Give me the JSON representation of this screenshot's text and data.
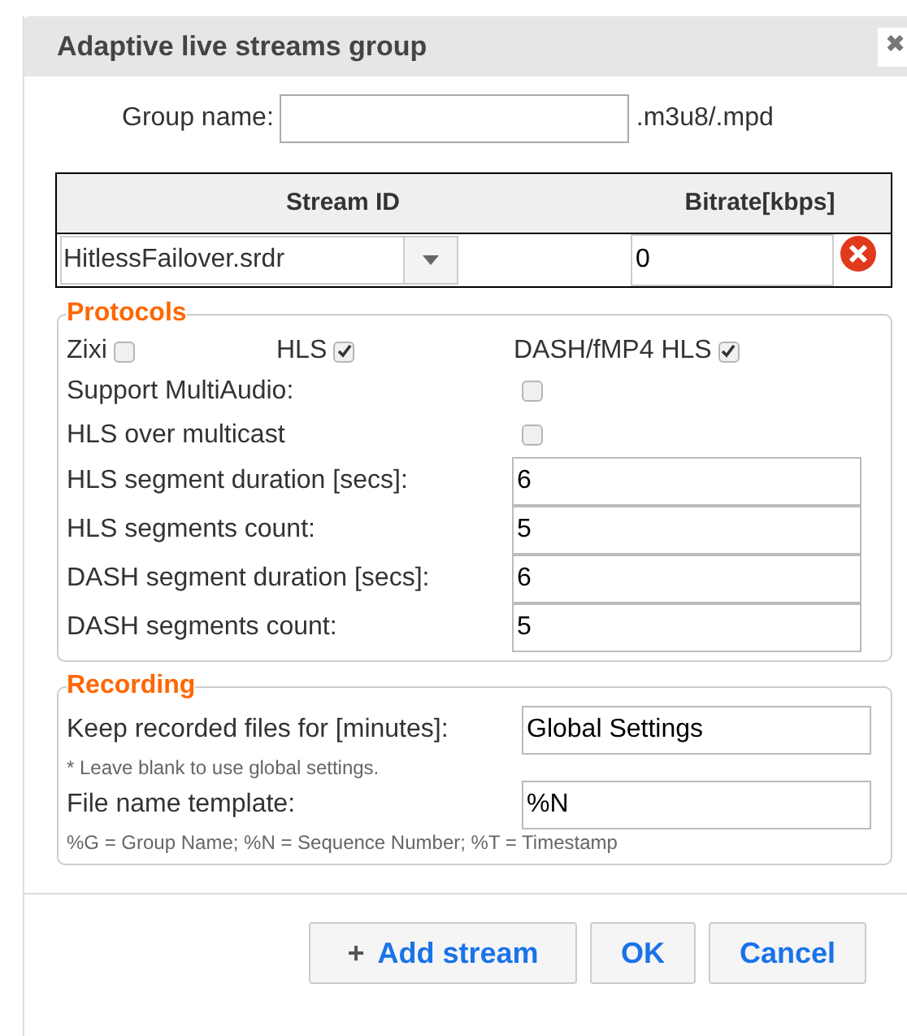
{
  "dialog": {
    "title": "Adaptive live streams group",
    "close": "✖"
  },
  "group_name": {
    "label": "Group name:",
    "suffix": ".m3u8/.mpd"
  },
  "table": {
    "columns": [
      "Stream ID",
      "Bitrate[kbps]"
    ],
    "rows": [
      {
        "stream_id": "HitlessFailover.srdr",
        "bitrate": "0"
      }
    ]
  },
  "protocols": {
    "legend": "Protocols",
    "inline": [
      {
        "label": "Zixi",
        "checked": false
      },
      {
        "label": "HLS",
        "checked": true
      },
      {
        "label": "DASH/fMP4 HLS",
        "checked": true
      }
    ],
    "options": [
      {
        "kind": "checkbox",
        "label": "Support MultiAudio:",
        "checked": false
      },
      {
        "kind": "checkbox",
        "label": "HLS over multicast",
        "checked": false
      },
      {
        "kind": "field",
        "label": "HLS segment duration [secs]:",
        "value": "6"
      },
      {
        "kind": "field",
        "label": "HLS segments count:",
        "value": "5"
      },
      {
        "kind": "field",
        "label": "DASH segment duration [secs]:",
        "value": "6"
      },
      {
        "kind": "field",
        "label": "DASH segments count:",
        "value": "5"
      }
    ]
  },
  "recording": {
    "legend": "Recording",
    "fields": [
      {
        "label": "Keep recorded files for [minutes]:",
        "value": "Global Settings",
        "hint": "* Leave blank to use global settings."
      },
      {
        "label": "File name template:",
        "value": "%N",
        "hint": "%G = Group Name; %N = Sequence Number; %T = Timestamp"
      }
    ]
  },
  "buttons": [
    {
      "kind": "add",
      "icon": "+",
      "label": "Add stream"
    },
    {
      "kind": "plain",
      "label": "OK"
    },
    {
      "kind": "plain",
      "label": "Cancel"
    }
  ]
}
